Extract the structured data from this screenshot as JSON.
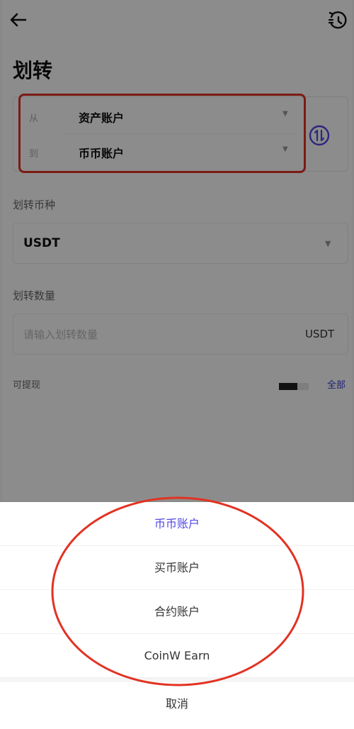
{
  "header": {
    "title": "划转",
    "back_icon": "arrow-left-icon",
    "history_icon": "history-icon"
  },
  "accounts": {
    "from_label": "从",
    "from_value": "资产账户",
    "to_label": "到",
    "to_value": "币币账户",
    "swap_icon": "swap-vertical-icon"
  },
  "coin": {
    "label": "划转币种",
    "value": "USDT"
  },
  "amount": {
    "label": "划转数量",
    "placeholder": "请输入划转数量",
    "unit": "USDT"
  },
  "available": {
    "label": "可提现",
    "all_label": "全部",
    "bar_fill": 0.62
  },
  "sheet": {
    "options": [
      {
        "label": "币币账户",
        "selected": true
      },
      {
        "label": "买币账户",
        "selected": false
      },
      {
        "label": "合约账户",
        "selected": false
      },
      {
        "label": "CoinW Earn",
        "selected": false
      }
    ],
    "cancel_label": "取消"
  },
  "colors": {
    "accent": "#5046e5",
    "annotation_red": "#e23222",
    "link": "#3b3bd6"
  }
}
